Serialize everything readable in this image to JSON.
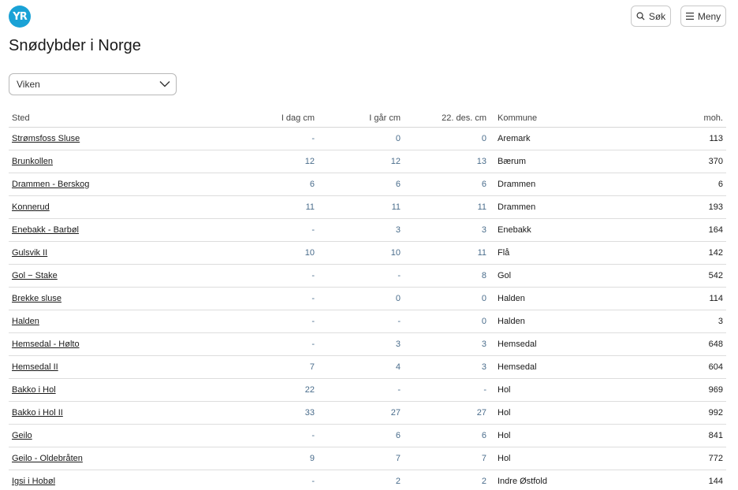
{
  "header": {
    "logo_text": "YR",
    "search_label": "Søk",
    "menu_label": "Meny"
  },
  "page_title": "Snødybder i Norge",
  "region_select": {
    "value": "Viken"
  },
  "table": {
    "columns": [
      "Sted",
      "I dag cm",
      "I går cm",
      "22. des. cm",
      "Kommune",
      "moh."
    ],
    "rows": [
      [
        "Strømsfoss Sluse",
        "-",
        "0",
        "0",
        "Aremark",
        "113"
      ],
      [
        "Brunkollen",
        "12",
        "12",
        "13",
        "Bærum",
        "370"
      ],
      [
        "Drammen - Berskog",
        "6",
        "6",
        "6",
        "Drammen",
        "6"
      ],
      [
        "Konnerud",
        "11",
        "11",
        "11",
        "Drammen",
        "193"
      ],
      [
        "Enebakk - Barbøl",
        "-",
        "3",
        "3",
        "Enebakk",
        "164"
      ],
      [
        "Gulsvik II",
        "10",
        "10",
        "11",
        "Flå",
        "142"
      ],
      [
        "Gol − Stake",
        "-",
        "-",
        "8",
        "Gol",
        "542"
      ],
      [
        "Brekke sluse",
        "-",
        "0",
        "0",
        "Halden",
        "114"
      ],
      [
        "Halden",
        "-",
        "-",
        "0",
        "Halden",
        "3"
      ],
      [
        "Hemsedal - Hølto",
        "-",
        "3",
        "3",
        "Hemsedal",
        "648"
      ],
      [
        "Hemsedal II",
        "7",
        "4",
        "3",
        "Hemsedal",
        "604"
      ],
      [
        "Bakko i Hol",
        "22",
        "-",
        "-",
        "Hol",
        "969"
      ],
      [
        "Bakko i Hol II",
        "33",
        "27",
        "27",
        "Hol",
        "992"
      ],
      [
        "Geilo",
        "-",
        "6",
        "6",
        "Hol",
        "841"
      ],
      [
        "Geilo - Oldebråten",
        "9",
        "7",
        "7",
        "Hol",
        "772"
      ],
      [
        "Igsi i Hobøl",
        "-",
        "2",
        "2",
        "Indre Østfold",
        "144"
      ]
    ]
  }
}
